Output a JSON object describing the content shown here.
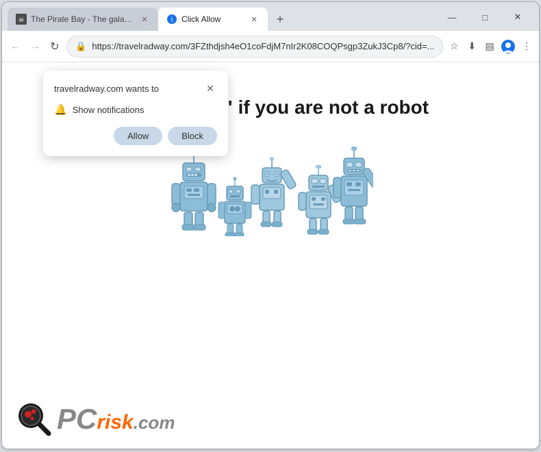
{
  "browser": {
    "tabs": [
      {
        "id": "tab1",
        "title": "The Pirate Bay - The galaxy's m...",
        "favicon": "pirate",
        "active": false
      },
      {
        "id": "tab2",
        "title": "Click Allow",
        "favicon": "shield",
        "active": true
      }
    ],
    "new_tab_label": "+",
    "window_controls": {
      "minimize": "—",
      "maximize": "□",
      "close": "✕"
    },
    "address_bar": {
      "url": "https://travelradway.com/3FZthdjsh4eO1coFdjM7nIr2K08COQPsgp3ZukJ3Cp8/?cid=...",
      "secure_icon": "🔒"
    },
    "nav": {
      "back": "←",
      "forward": "→",
      "refresh": "↻",
      "star_icon": "☆",
      "download_icon": "⬇",
      "profile_icon": "👤",
      "menu_icon": "⋮",
      "reader_icon": "▤"
    }
  },
  "notification_popup": {
    "title": "travelradway.com wants to",
    "close_icon": "✕",
    "permission_text": "Show notifications",
    "bell_icon": "🔔",
    "allow_label": "Allow",
    "block_label": "Block"
  },
  "page": {
    "heading": "Click \"Allow\"  if you are not  a robot"
  },
  "footer": {
    "brand_pc": "PC",
    "brand_risk": "risk",
    "brand_dotcom": ".com"
  }
}
